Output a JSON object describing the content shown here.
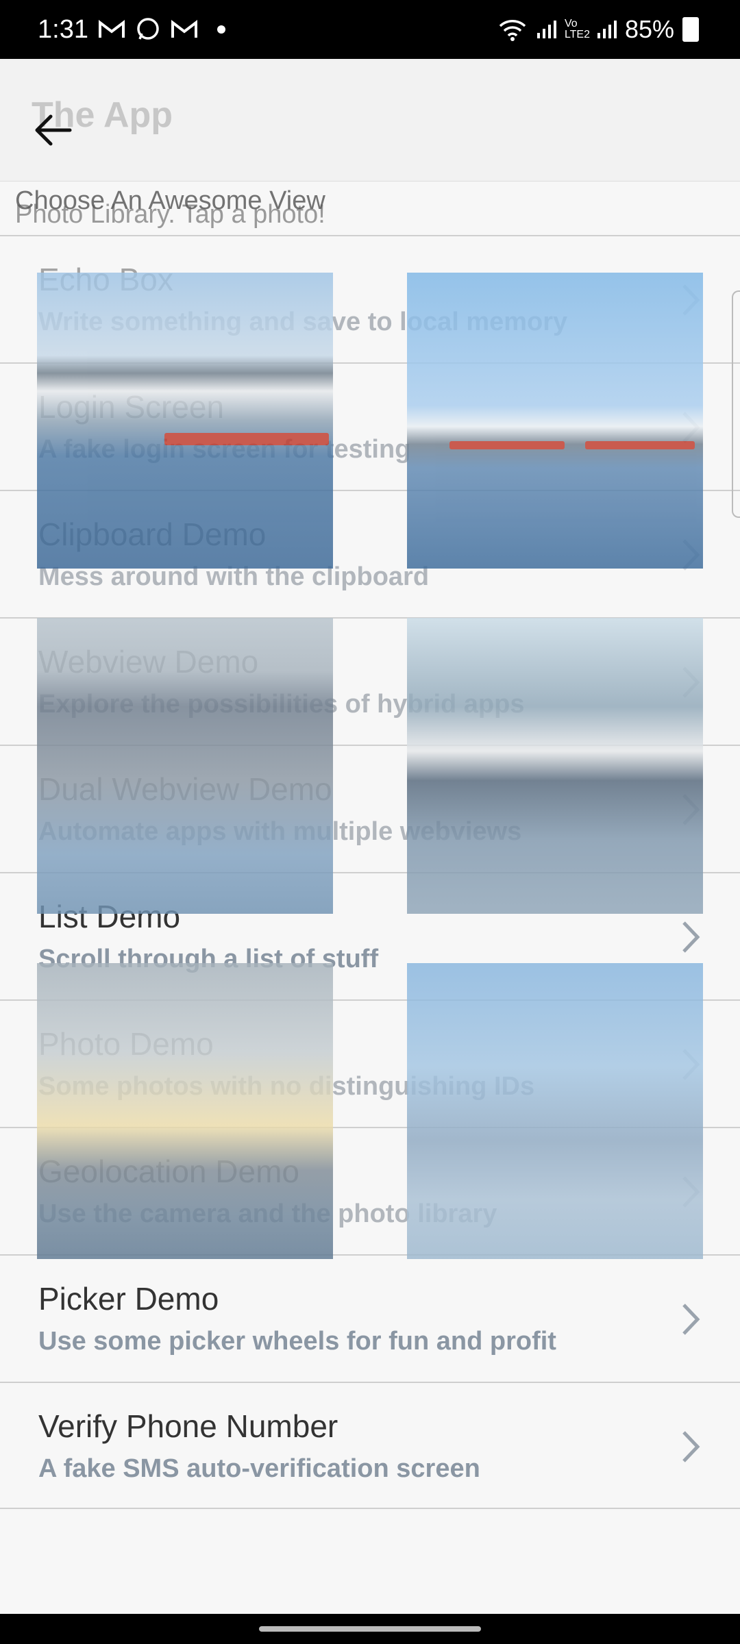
{
  "status_bar": {
    "time": "1:31",
    "battery": "85%",
    "network_label": "Vo LTE2",
    "icons": [
      "gmail-icon",
      "whatsapp-icon",
      "gmail-icon",
      "wifi-icon",
      "signal-icon",
      "signal-icon",
      "battery-charging-icon"
    ]
  },
  "header": {
    "title": "The App",
    "back_icon": "arrow-left-icon"
  },
  "subtitles": {
    "choose_view": "Choose An Awesome View",
    "photo_library": "Photo Library. Tap a photo!"
  },
  "items": [
    {
      "title": "Echo Box",
      "subtitle": "Write something and save to local memory"
    },
    {
      "title": "Login Screen",
      "subtitle": "A fake login screen for testing"
    },
    {
      "title": "Clipboard Demo",
      "subtitle": "Mess around with the clipboard"
    },
    {
      "title": "Webview Demo",
      "subtitle": "Explore the possibilities of hybrid apps"
    },
    {
      "title": "Dual Webview Demo",
      "subtitle": "Automate apps with multiple webviews"
    },
    {
      "title": "List Demo",
      "subtitle": "Scroll through a list of stuff"
    },
    {
      "title": "Photo Demo",
      "subtitle": "Some photos with no distinguishing IDs"
    },
    {
      "title": "Geolocation Demo",
      "subtitle": "Use the camera and the photo library"
    },
    {
      "title": "Picker Demo",
      "subtitle": "Use some picker wheels for fun and profit"
    },
    {
      "title": "Verify Phone Number",
      "subtitle": "A fake SMS auto-verification screen"
    }
  ],
  "colors": {
    "subtitle": "#8a96a3",
    "title": "#333333",
    "divider": "#cfcfcf"
  }
}
